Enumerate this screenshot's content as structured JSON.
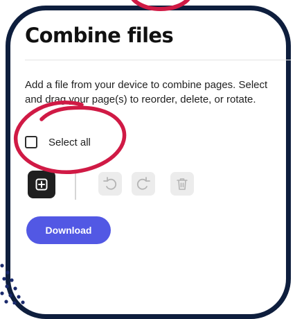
{
  "dialog": {
    "title": "Combine files",
    "description": "Add a file from your device to combine pages. Select and drag your page(s) to reorder, delete, or rotate.",
    "select_all_label": "Select all",
    "download_label": "Download"
  },
  "toolbar": {
    "icons": [
      "add-file-icon",
      "rotate-left-icon",
      "rotate-right-icon",
      "delete-icon"
    ]
  },
  "colors": {
    "frame_border": "#0e1e3d",
    "accent": "#5258e4",
    "annotation": "#d01a45",
    "add_button": "#1f1f1f"
  }
}
